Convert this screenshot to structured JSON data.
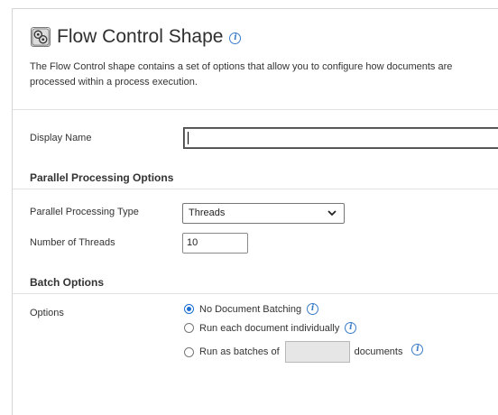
{
  "header": {
    "icon": "flow-control-shape-icon",
    "title": "Flow Control Shape",
    "info_icon": "info-icon",
    "description": "The Flow Control shape contains a set of options that allow you to configure how documents are processed within a process execution."
  },
  "display_name": {
    "label": "Display Name",
    "value": ""
  },
  "parallel_processing": {
    "section_title": "Parallel Processing Options",
    "type_label": "Parallel Processing Type",
    "type_selected": "Threads",
    "threads_label": "Number of Threads",
    "threads_value": "10"
  },
  "batch": {
    "section_title": "Batch Options",
    "options_label": "Options",
    "option_none": "No Document Batching",
    "option_individual": "Run each document individually",
    "option_batches_prefix": "Run as batches of",
    "option_batches_suffix": "documents",
    "batch_size_value": "",
    "selected_option": "No Document Batching"
  },
  "colors": {
    "accent": "#1a6fd1",
    "info": "#3a7bc8"
  }
}
